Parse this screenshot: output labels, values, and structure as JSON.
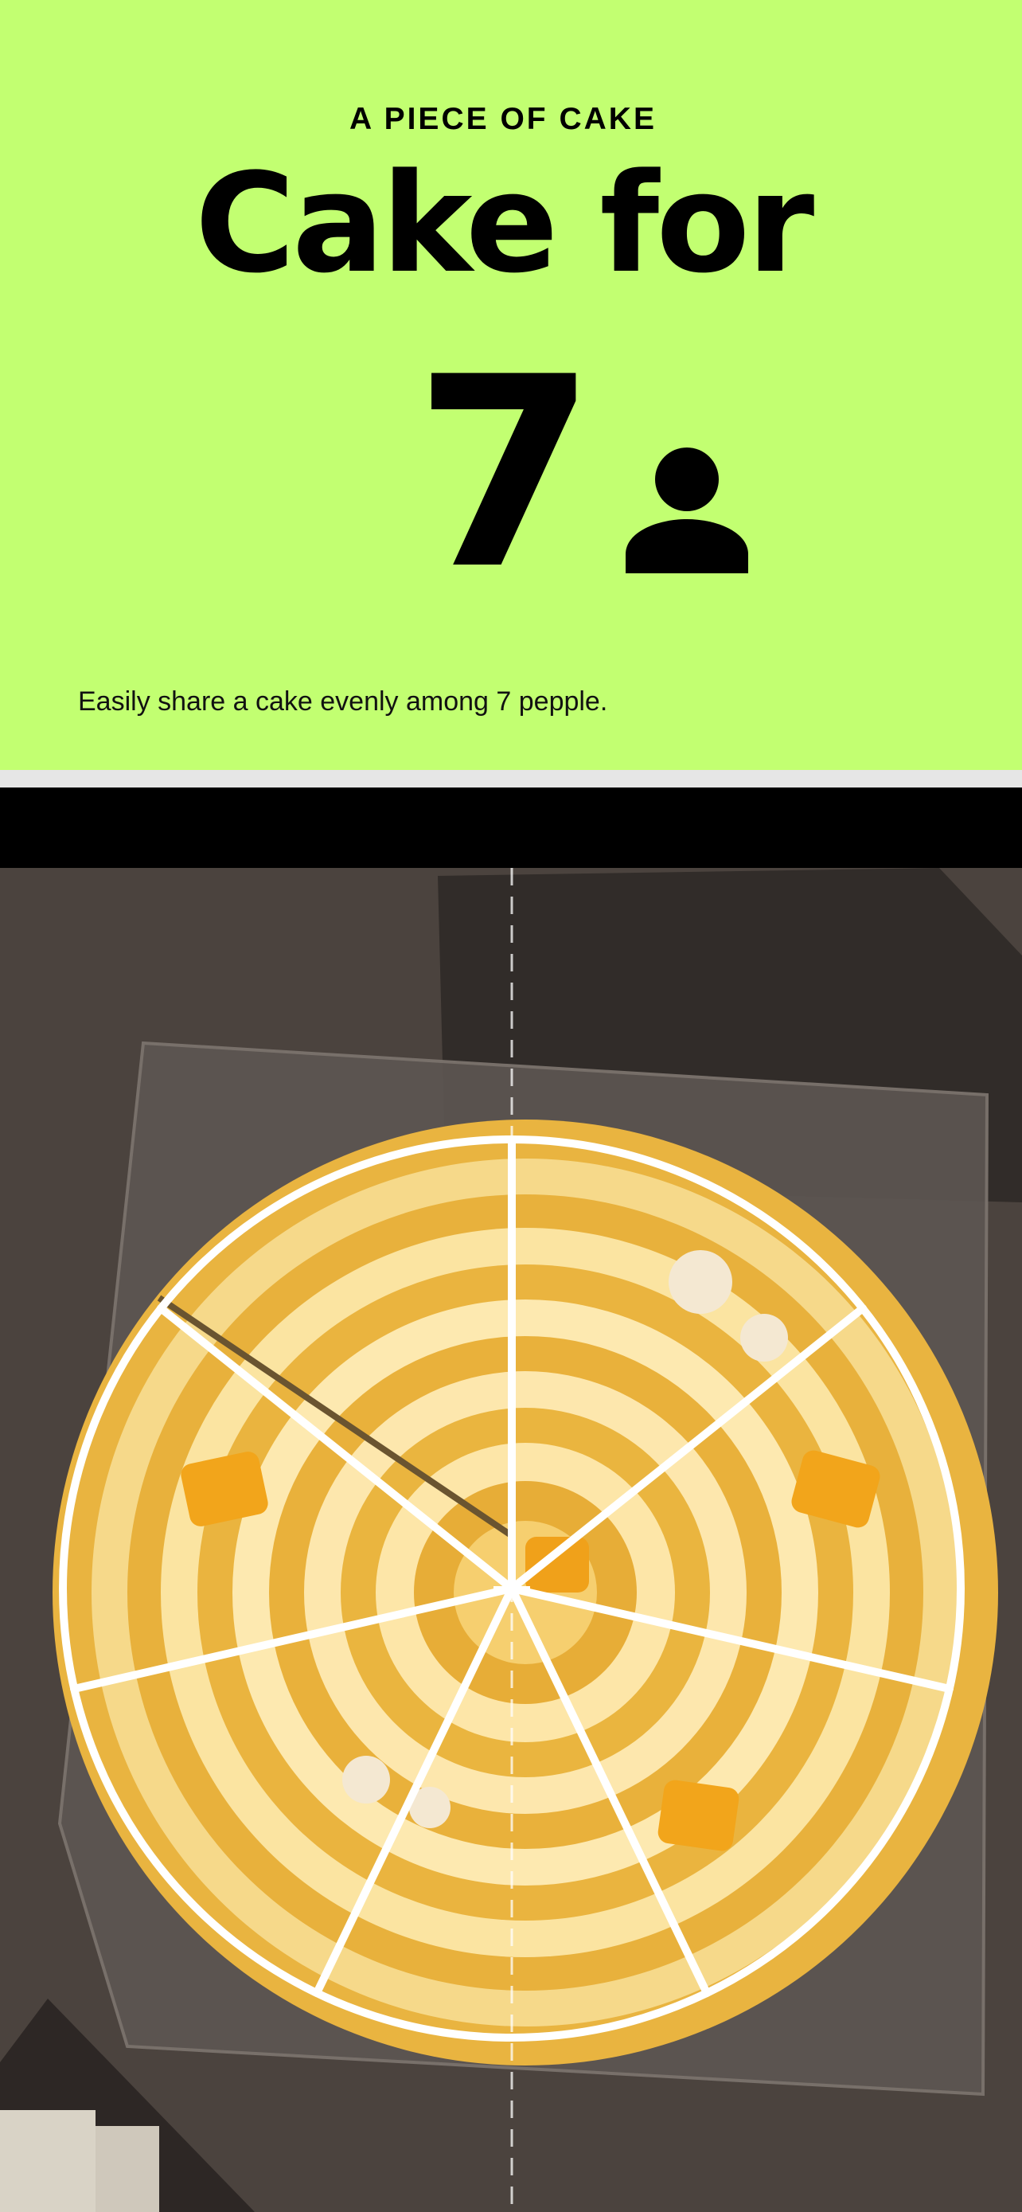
{
  "header": {
    "kicker": "A PIECE OF CAKE",
    "title": "Cake for",
    "count": "7",
    "count_icon": "person-icon",
    "description": "Easily share a cake evenly among 7 pepple."
  },
  "camera": {
    "slices": 7,
    "guide_color": "#ffffff",
    "background_color": "#4b433e",
    "cake_color": "#f0bf4a"
  },
  "colors": {
    "accent": "#c2ff71",
    "text": "#000000"
  }
}
